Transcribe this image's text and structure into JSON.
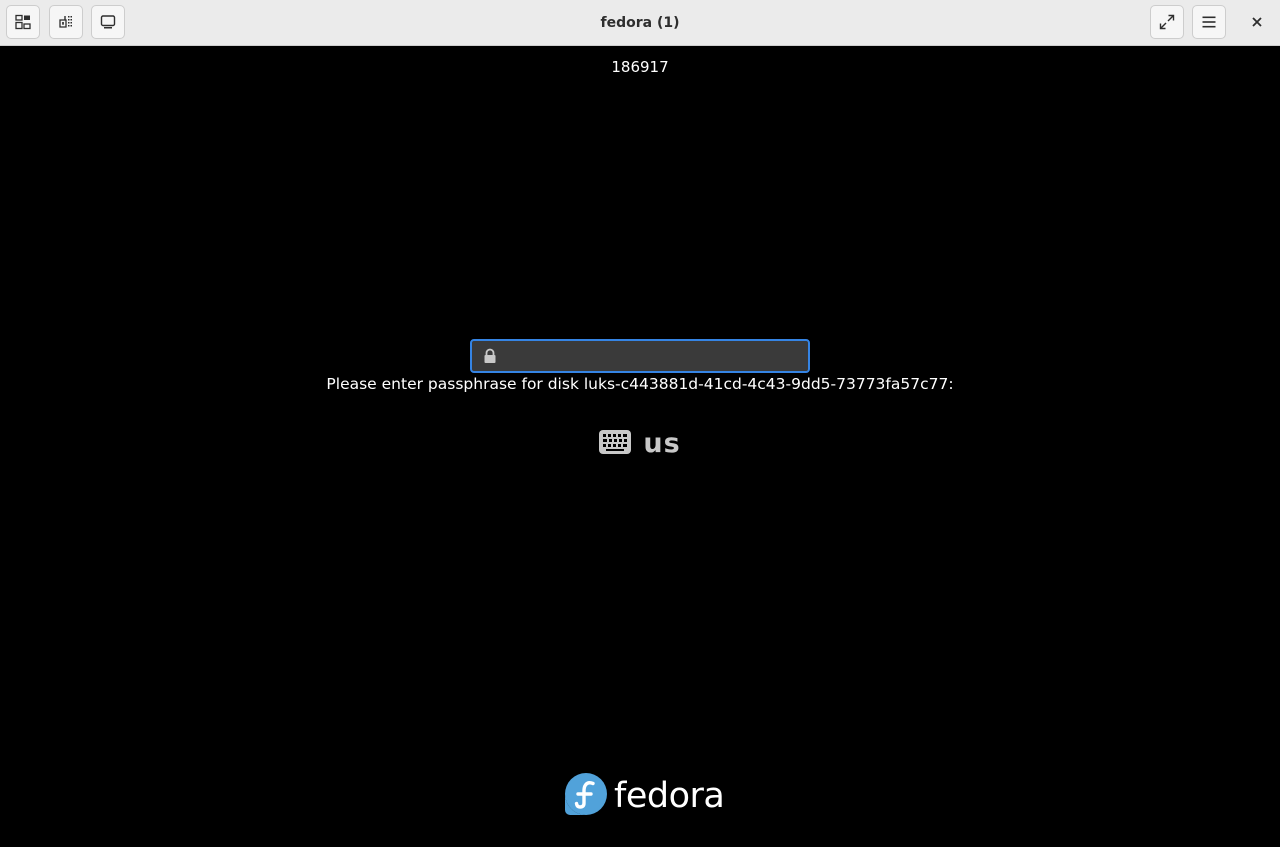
{
  "window": {
    "title": "fedora (1)"
  },
  "headerbar": {
    "left_buttons": [
      {
        "icon": "remote-desktop-icon"
      },
      {
        "icon": "keyboard-shortcuts-icon"
      },
      {
        "icon": "display-icon"
      }
    ],
    "right_buttons": [
      {
        "icon": "fullscreen-icon"
      },
      {
        "icon": "hamburger-menu-icon"
      },
      {
        "icon": "close-icon"
      }
    ]
  },
  "boot": {
    "counter": "186917",
    "passphrase": {
      "value": "",
      "placeholder": ""
    },
    "prompt": "Please enter passphrase for disk luks-c443881d-41cd-4c43-9dd5-73773fa57c77:",
    "keyboard_layout": "us",
    "brand_name": "fedora"
  },
  "colors": {
    "accent": "#3584e4",
    "background": "#000000",
    "fedora_blue": "#51a2da",
    "headerbar": "#ebebeb"
  }
}
